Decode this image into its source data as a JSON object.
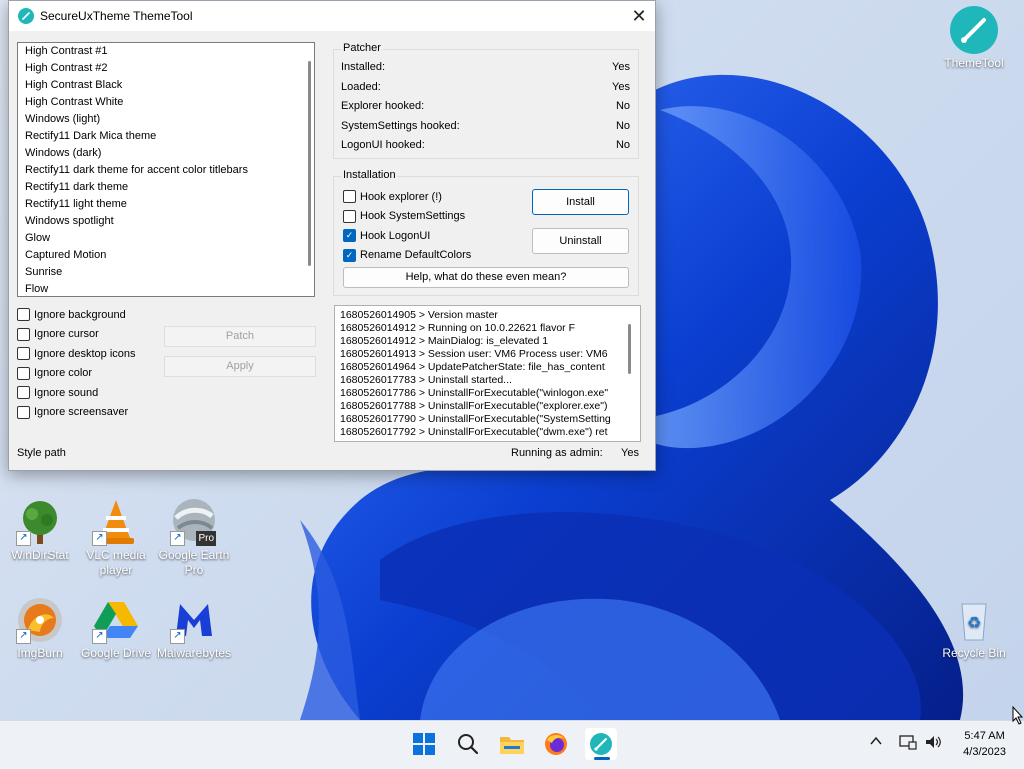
{
  "window": {
    "title": "SecureUxTheme ThemeTool",
    "close_glyph": "✕"
  },
  "themes": [
    "High Contrast #1",
    "High Contrast #2",
    "High Contrast Black",
    "High Contrast White",
    "Windows (light)",
    "Rectify11 Dark Mica theme",
    "Windows (dark)",
    "Rectify11 dark theme for accent color titlebars",
    "Rectify11 dark theme",
    "Rectify11 light theme",
    "Windows spotlight",
    "Glow",
    "Captured Motion",
    "Sunrise",
    "Flow"
  ],
  "ignore_options": [
    {
      "label": "Ignore background",
      "checked": false
    },
    {
      "label": "Ignore cursor",
      "checked": false
    },
    {
      "label": "Ignore desktop icons",
      "checked": false
    },
    {
      "label": "Ignore color",
      "checked": false
    },
    {
      "label": "Ignore sound",
      "checked": false
    },
    {
      "label": "Ignore screensaver",
      "checked": false
    }
  ],
  "buttons": {
    "patch": "Patch",
    "apply": "Apply",
    "install": "Install",
    "uninstall": "Uninstall",
    "help": "Help, what do these even mean?"
  },
  "style_path_label": "Style path",
  "patcher": {
    "legend": "Patcher",
    "rows": [
      {
        "label": "Installed:",
        "value": "Yes"
      },
      {
        "label": "Loaded:",
        "value": "Yes"
      },
      {
        "label": "Explorer hooked:",
        "value": "No"
      },
      {
        "label": "SystemSettings hooked:",
        "value": "No"
      },
      {
        "label": "LogonUI hooked:",
        "value": "No"
      }
    ]
  },
  "installation": {
    "legend": "Installation",
    "options": [
      {
        "label": "Hook explorer (!)",
        "checked": false
      },
      {
        "label": "Hook SystemSettings",
        "checked": false
      },
      {
        "label": "Hook LogonUI",
        "checked": true
      },
      {
        "label": "Rename DefaultColors",
        "checked": true
      }
    ]
  },
  "log_lines": [
    "1680526014905 > Version master",
    "1680526014912 > Running on 10.0.22621 flavor F",
    "1680526014912 > MainDialog: is_elevated 1",
    "1680526014913 > Session user: VM6 Process user: VM6",
    "1680526014964 > UpdatePatcherState: file_has_content",
    "1680526017783 > Uninstall started...",
    "1680526017786 > UninstallForExecutable(\"winlogon.exe\"",
    "1680526017788 > UninstallForExecutable(\"explorer.exe\")",
    "1680526017790 > UninstallForExecutable(\"SystemSetting",
    "1680526017792 > UninstallForExecutable(\"dwm.exe\") ret"
  ],
  "admin": {
    "label": "Running as admin:",
    "value": "Yes"
  },
  "desktop_icons": [
    {
      "label": "WinDirStat",
      "icon": "tree-icon"
    },
    {
      "label": "VLC media player",
      "icon": "vlc-cone-icon"
    },
    {
      "label": "Google Earth Pro",
      "icon": "globe-icon",
      "badge": "Pro"
    },
    {
      "label": "ImgBurn",
      "icon": "disc-icon"
    },
    {
      "label": "Google Drive",
      "icon": "drive-icon"
    },
    {
      "label": "Malwarebytes",
      "icon": "malwarebytes-icon"
    },
    {
      "label": "ThemeTool",
      "icon": "themetool-icon"
    },
    {
      "label": "Recycle Bin",
      "icon": "recycle-bin-icon"
    }
  ],
  "clock": {
    "time": "5:47 AM",
    "date": "4/3/2023"
  },
  "colors": {
    "accent": "#0067c0",
    "themetool": "#1fb7b9"
  }
}
